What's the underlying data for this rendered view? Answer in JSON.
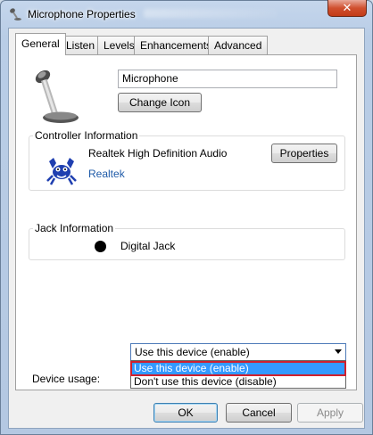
{
  "window": {
    "title": "Microphone Properties",
    "close_glyph": "✕"
  },
  "tabs": [
    {
      "label": "General",
      "active": true
    },
    {
      "label": "Listen"
    },
    {
      "label": "Levels"
    },
    {
      "label": "Enhancements"
    },
    {
      "label": "Advanced"
    }
  ],
  "general": {
    "device_name": "Microphone",
    "change_icon_label": "Change Icon"
  },
  "controller": {
    "group_title": "Controller Information",
    "name": "Realtek High Definition Audio",
    "vendor": "Realtek",
    "properties_label": "Properties"
  },
  "jack": {
    "group_title": "Jack Information",
    "name": "Digital Jack"
  },
  "usage": {
    "label": "Device usage:",
    "selected": "Use this device (enable)",
    "options": [
      "Use this device (enable)",
      "Don't use this device (disable)"
    ]
  },
  "footer": {
    "ok": "OK",
    "cancel": "Cancel",
    "apply": "Apply"
  },
  "colors": {
    "selection": "#3399ff",
    "highlight_border": "#d0202e",
    "link": "#1e5aa8"
  }
}
